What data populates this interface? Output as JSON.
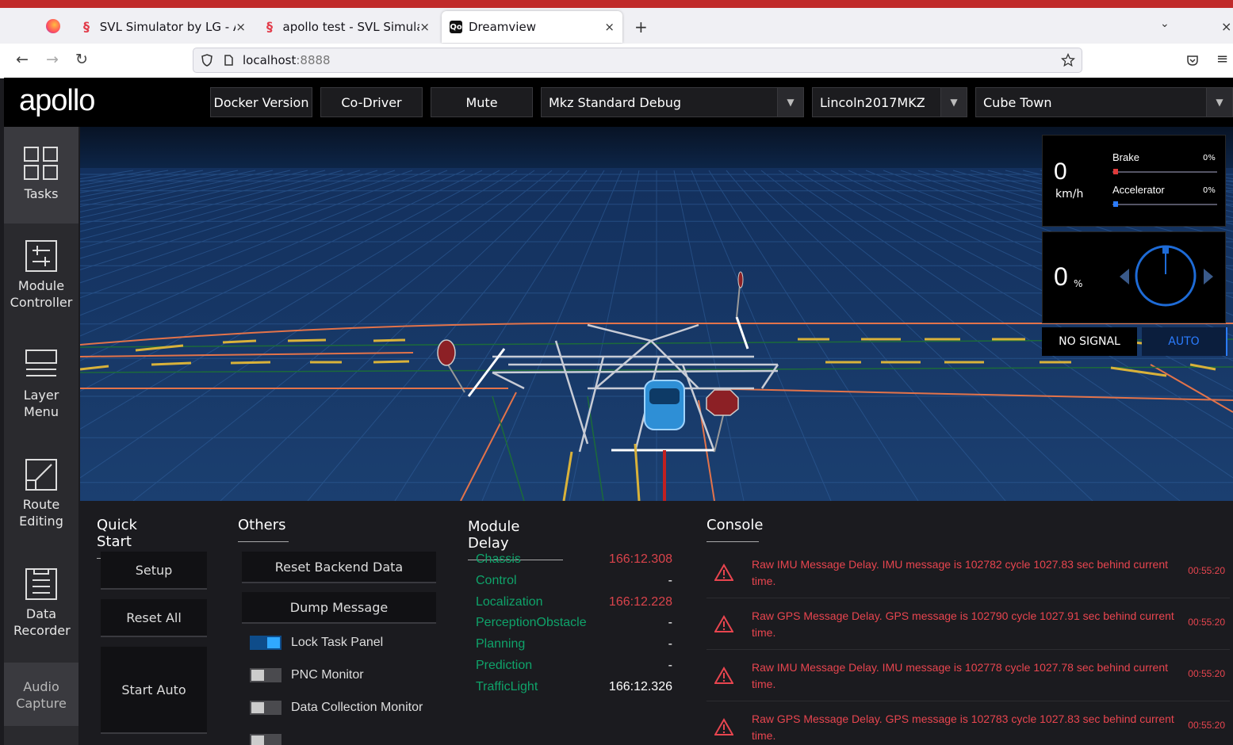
{
  "browser": {
    "tabs": [
      {
        "label": "SVL Simulator by LG - Au"
      },
      {
        "label": "apollo test - SVL Simulato"
      },
      {
        "label": "Dreamview"
      }
    ],
    "url_host": "localhost",
    "url_port": ":8888",
    "new_tab": "+"
  },
  "header": {
    "logo": "apollo",
    "buttons": [
      "Docker Version",
      "Co-Driver",
      "Mute"
    ],
    "mode_select": "Mkz Standard Debug",
    "vehicle_select": "Lincoln2017MKZ",
    "map_select": "Cube Town"
  },
  "sidebar": {
    "items": [
      {
        "label": "Tasks",
        "icon": "tasks-icon"
      },
      {
        "label": "Module Controller",
        "icon": "module-controller-icon"
      },
      {
        "label": "Layer Menu",
        "icon": "layer-menu-icon"
      },
      {
        "label": "Route Editing",
        "icon": "route-editing-icon"
      },
      {
        "label": "Data Recorder",
        "icon": "data-recorder-icon"
      },
      {
        "label": "Audio Capture",
        "icon": "audio-capture-icon"
      }
    ]
  },
  "dashboard": {
    "speed": "0",
    "speed_unit": "km/h",
    "brake_label": "Brake",
    "brake_value": "0%",
    "accel_label": "Accelerator",
    "accel_value": "0%",
    "steering": "0",
    "steering_unit": "%",
    "signal": "NO SIGNAL",
    "drive_mode": "AUTO",
    "brake_color": "#e03a3a",
    "accel_color": "#2b7cff"
  },
  "quick_start": {
    "title": "Quick Start",
    "buttons": [
      "Setup",
      "Reset All",
      "Start Auto"
    ]
  },
  "others": {
    "title": "Others",
    "buttons": [
      "Reset Backend Data",
      "Dump Message"
    ],
    "toggles": [
      {
        "label": "Lock Task Panel",
        "on": true
      },
      {
        "label": "PNC Monitor",
        "on": false
      },
      {
        "label": "Data Collection Monitor",
        "on": false
      }
    ]
  },
  "module_delay": {
    "title": "Module Delay",
    "rows": [
      {
        "name": "Chassis",
        "value": "166:12.308",
        "alert": true
      },
      {
        "name": "Control",
        "value": "-",
        "alert": false
      },
      {
        "name": "Localization",
        "value": "166:12.228",
        "alert": true
      },
      {
        "name": "PerceptionObstacle",
        "value": "-",
        "alert": false
      },
      {
        "name": "Planning",
        "value": "-",
        "alert": false
      },
      {
        "name": "Prediction",
        "value": "-",
        "alert": false
      },
      {
        "name": "TrafficLight",
        "value": "166:12.326",
        "alert": false
      }
    ]
  },
  "console": {
    "title": "Console",
    "messages": [
      {
        "text": "Raw IMU Message Delay. IMU message is 102782 cycle 1027.83 sec behind current time.",
        "time": "00:55:20"
      },
      {
        "text": "Raw GPS Message Delay. GPS message is 102790 cycle 1027.91 sec behind current time.",
        "time": "00:55:20"
      },
      {
        "text": "Raw IMU Message Delay. IMU message is 102778 cycle 1027.78 sec behind current time.",
        "time": "00:55:20"
      },
      {
        "text": "Raw GPS Message Delay. GPS message is 102783 cycle 1027.83 sec behind current time.",
        "time": "00:55:20"
      }
    ]
  }
}
